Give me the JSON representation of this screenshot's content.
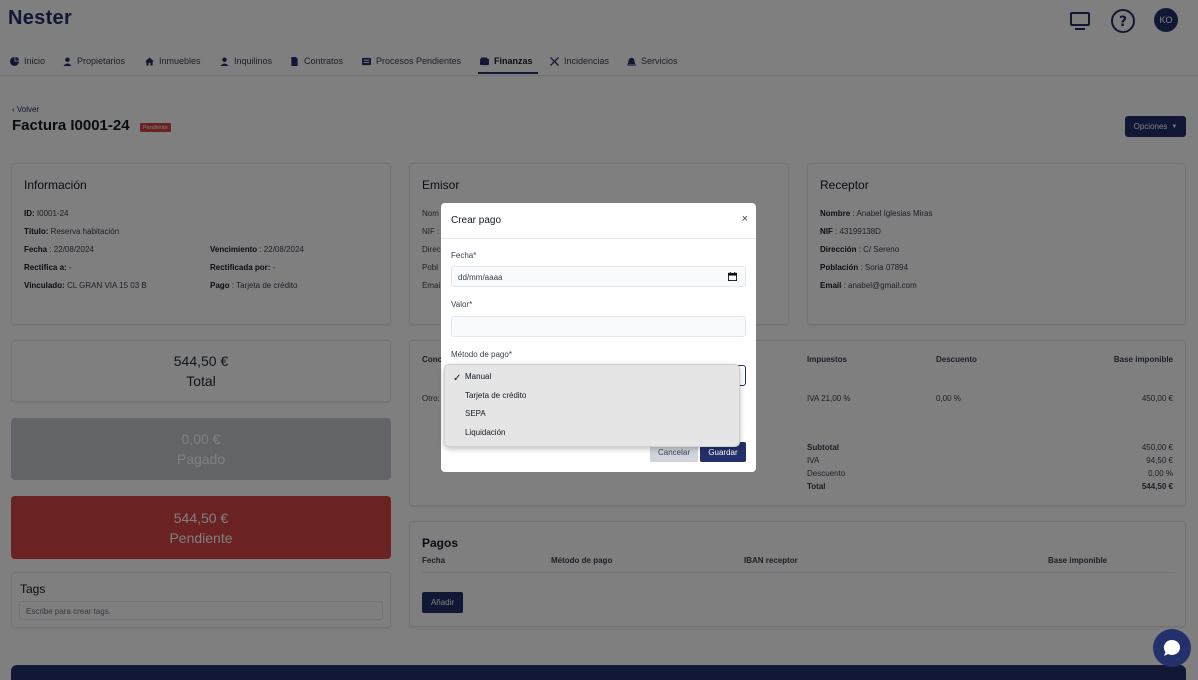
{
  "header": {
    "logo": "Nester",
    "avatar_initials": "KO"
  },
  "nav": {
    "items": [
      {
        "label": "Inicio",
        "icon": "pie-chart-icon"
      },
      {
        "label": "Propietarios",
        "icon": "user-icon"
      },
      {
        "label": "Inmuebles",
        "icon": "home-icon"
      },
      {
        "label": "Inquilinos",
        "icon": "user-icon"
      },
      {
        "label": "Contratos",
        "icon": "file-icon"
      },
      {
        "label": "Procesos Pendientes",
        "icon": "list-icon"
      },
      {
        "label": "Finanzas",
        "icon": "wallet-icon",
        "active": true
      },
      {
        "label": "Incidencias",
        "icon": "tools-icon"
      },
      {
        "label": "Servicios",
        "icon": "bell-icon"
      }
    ]
  },
  "page": {
    "back": "Volver",
    "title": "Factura I0001-24",
    "status_badge": "Pendiente",
    "options_button": "Opciones"
  },
  "info": {
    "title": "Información",
    "id_label": "ID:",
    "id_value": "I0001-24",
    "titulo_label": "Título:",
    "titulo_value": "Reserva habitación",
    "fecha_label": "Fecha",
    "fecha_value": ": 22/08/2024",
    "vencimiento_label": "Vencimiento",
    "vencimiento_value": ": 22/08/2024",
    "rectifica_label": "Rectifica a:",
    "rectifica_value": "-",
    "rectificada_label": "Rectificada por:",
    "rectificada_value": "-",
    "vinculado_label": "Vinculado:",
    "vinculado_value": "CL GRAN VIA 15 03 B",
    "pago_label": "Pago",
    "pago_value": ": Tarjeta de crédito"
  },
  "emisor": {
    "title": "Emisor",
    "labels": [
      "Nom",
      "NIF :",
      "Direc",
      "Pobl",
      "Emai"
    ]
  },
  "receptor": {
    "title": "Receptor",
    "nombre_label": "Nombre",
    "nombre_value": ": Anabel Iglesias Miras",
    "nif_label": "NIF",
    "nif_value": ": 43199138D",
    "direccion_label": "Dirección",
    "direccion_value": ": C/ Sereno",
    "poblacion_label": "Población",
    "poblacion_value": ": Soria 07894",
    "email_label": "Email",
    "email_value": ": anabel@gmail.com"
  },
  "totals": {
    "total_value": "544,50 €",
    "total_label": "Total",
    "pagado_value": "0,00 €",
    "pagado_label": "Pagado",
    "pendiente_value": "544,50 €",
    "pendiente_label": "Pendiente"
  },
  "tags": {
    "title": "Tags",
    "placeholder": "Escribe para crear tags."
  },
  "concepts": {
    "header_concept": "Conc",
    "header_impuestos": "Impuestos",
    "header_descuento": "Descuento",
    "header_base": "Base imponible",
    "row_concept": "Otro:",
    "row_impuestos": "IVA 21,00 %",
    "row_descuento": "0,00 %",
    "row_base": "450,00 €",
    "subtotal_label": "Subtotal",
    "subtotal_value": "450,00 €",
    "iva_label": "IVA",
    "iva_value": "94,50 €",
    "descuento_label": "Descuento",
    "descuento_value": "0,00 %",
    "total_label": "Total",
    "total_value": "544,50 €"
  },
  "pagos": {
    "title": "Pagos",
    "headers": [
      "Fecha",
      "Método de pago",
      "IBAN receptor",
      "Base imponible"
    ],
    "add_button": "Añadir"
  },
  "modal": {
    "title": "Crear pago",
    "close": "×",
    "fecha_label": "Fecha*",
    "fecha_placeholder": "dd/mm/aaaa",
    "valor_label": "Valor*",
    "metodo_label": "Método de pago*",
    "cancel_button": "Cancelar",
    "save_button": "Guardar"
  },
  "dropdown": {
    "selected": "Manual",
    "options": [
      "Manual",
      "Tarjeta de crédito",
      "SEPA",
      "Liquidación"
    ]
  },
  "colors": {
    "brand": "#23306b",
    "danger": "#d64545",
    "paid": "#c4c9cf"
  }
}
